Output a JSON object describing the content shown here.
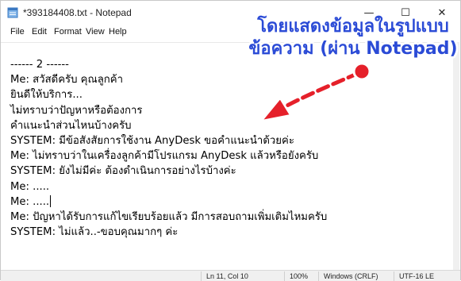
{
  "window": {
    "title": "*393184408.txt - Notepad",
    "minimize_glyph": "—",
    "maximize_glyph": "☐",
    "close_glyph": "✕"
  },
  "menu": {
    "items": [
      {
        "label": "File"
      },
      {
        "label": "Edit"
      },
      {
        "label": "Format"
      },
      {
        "label": "View"
      },
      {
        "label": "Help"
      }
    ]
  },
  "editor": {
    "lines": [
      "------ 2 ------",
      "Me: สวัสดีครับ คุณลูกค้า",
      "ยินดีให้บริการ...",
      "ไม่ทราบว่าปัญหาหรือต้องการ",
      "คำแนะนำส่วนไหนบ้างครับ",
      "SYSTEM: มีข้อสังสัยการใช้งาน AnyDesk ขอคำแนะนำด้วยค่ะ",
      "Me: ไม่ทราบว่าในเครื่องลูกค้ามีโปรแกรม AnyDesk แล้วหรือยังครับ",
      "SYSTEM: ยังไม่มีค่ะ ต้องดำเนินการอย่างไรบ้างค่ะ",
      "Me: .....",
      "Me: .....",
      "Me: ปัญหาได้รับการแก้ไขเรียบร้อยแล้ว มีการสอบถามเพิ่มเติมไหมครับ",
      "SYSTEM: ไม่แล้ว..-ขอบคุณมากๆ ค่ะ"
    ],
    "caret_line": 10
  },
  "status": {
    "position": "Ln 11, Col 10",
    "zoom": "100%",
    "line_endings": "Windows (CRLF)",
    "encoding": "UTF-16 LE"
  },
  "annotation": {
    "line1": "โดยแสดงข้อมูลในรูปแบบ",
    "line2": "ข้อความ (ผ่าน Notepad)",
    "text_color": "#2b4bd6",
    "arrow_color": "#e5202a"
  }
}
